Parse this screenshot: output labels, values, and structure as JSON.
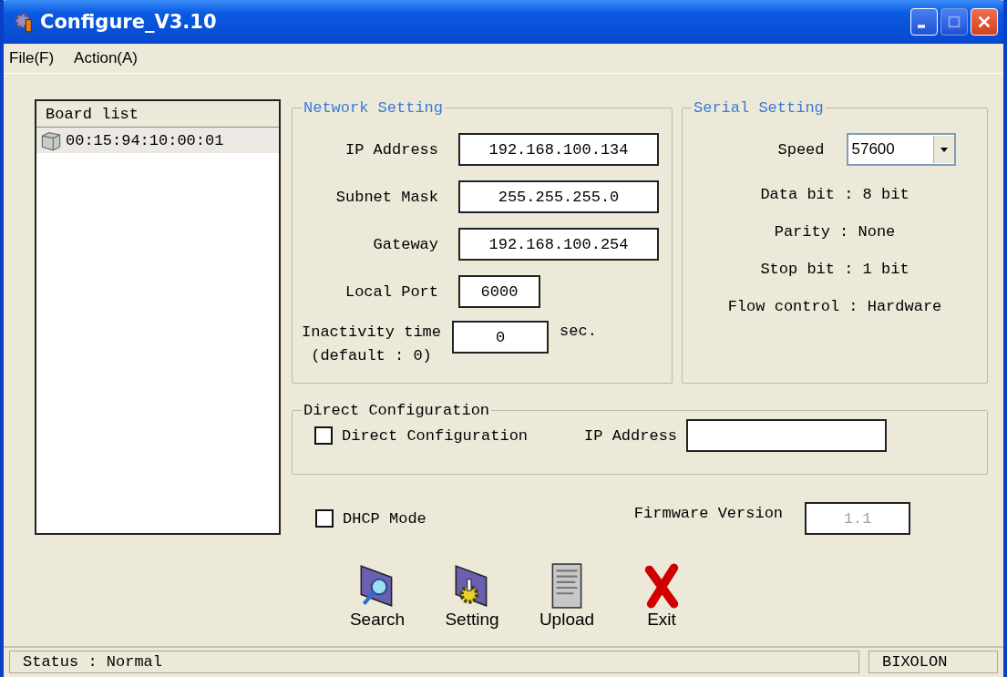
{
  "window": {
    "title": "Configure_V3.10"
  },
  "menu": [
    {
      "label": "File(F)"
    },
    {
      "label": "Action(A)"
    }
  ],
  "board_list": {
    "header": "Board list",
    "items": [
      {
        "label": "00:15:94:10:00:01",
        "selected": true
      }
    ]
  },
  "network_setting": {
    "title": "Network Setting",
    "fields": [
      {
        "label": "IP Address",
        "value": "192.168.100.134",
        "kind": "wide"
      },
      {
        "label": "Subnet Mask",
        "value": "255.255.255.0",
        "kind": "wide"
      },
      {
        "label": "Gateway",
        "value": "192.168.100.254",
        "kind": "wide"
      },
      {
        "label": "Local Port",
        "value": "6000",
        "kind": "short"
      }
    ],
    "inactivity": {
      "label": "Inactivity time",
      "hint": "(default : 0)",
      "value": "0",
      "unit": "sec."
    }
  },
  "serial_setting": {
    "title": "Serial Setting",
    "speed": {
      "label": "Speed",
      "value": "57600"
    },
    "lines": [
      "Data bit : 8 bit",
      "Parity : None",
      "Stop bit : 1 bit",
      "Flow control : Hardware"
    ]
  },
  "direct_configuration": {
    "title": "Direct Configuration",
    "checkbox": {
      "label": "Direct Configuration",
      "checked": false
    },
    "ip": {
      "label": "IP Address"
    }
  },
  "dhcp": {
    "label": "DHCP Mode",
    "checked": false
  },
  "firmware": {
    "label": "Firmware Version",
    "value": "1.1",
    "disabled": true
  },
  "toolbar": [
    {
      "label": "Search",
      "kind": "search"
    },
    {
      "label": "Setting",
      "kind": "setting"
    },
    {
      "label": "Upload",
      "kind": "upload"
    },
    {
      "label": "Exit",
      "kind": "exit"
    }
  ],
  "status_bar": {
    "status": "Status : Normal",
    "brand": "BIXOLON"
  }
}
